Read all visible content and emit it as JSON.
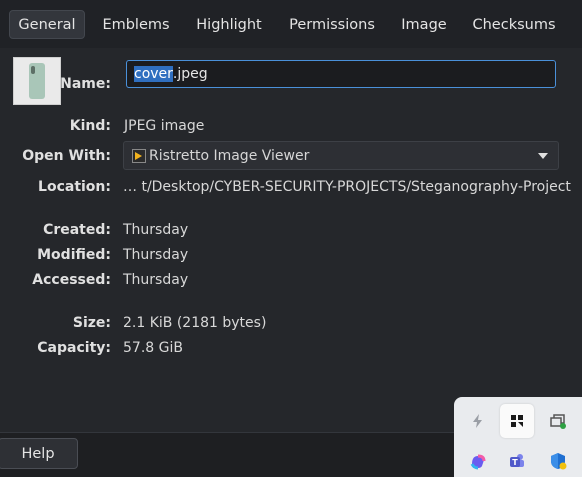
{
  "tabs": [
    {
      "label": "General",
      "active": true
    },
    {
      "label": "Emblems",
      "active": false
    },
    {
      "label": "Highlight",
      "active": false
    },
    {
      "label": "Permissions",
      "active": false
    },
    {
      "label": "Image",
      "active": false
    },
    {
      "label": "Checksums",
      "active": false
    }
  ],
  "file": {
    "thumbnail_icon": "image-thumbnail",
    "name_label": "Name:",
    "name_selected": "cover",
    "name_rest": ".jpeg"
  },
  "fields": {
    "kind_label": "Kind:",
    "kind_value": "JPEG image",
    "open_with_label": "Open With:",
    "open_with_value": "Ristretto Image Viewer",
    "location_label": "Location:",
    "location_value": "… t/Desktop/CYBER-SECURITY-PROJECTS/Steganography-Project",
    "created_label": "Created:",
    "created_value": "Thursday",
    "modified_label": "Modified:",
    "modified_value": "Thursday",
    "accessed_label": "Accessed:",
    "accessed_value": "Thursday",
    "size_label": "Size:",
    "size_value": "2.1 KiB (2181 bytes)",
    "capacity_label": "Capacity:",
    "capacity_value": "57.8 GiB"
  },
  "footer": {
    "help_label": "Help"
  },
  "tray": {
    "icons": [
      "bolt-icon",
      "app-grid-icon",
      "windows-icon",
      "copilot-icon",
      "teams-icon",
      "defender-shield-icon"
    ]
  },
  "colors": {
    "accent": "#4a90d9",
    "selection": "#2f6fc0",
    "background": "#25272b"
  }
}
